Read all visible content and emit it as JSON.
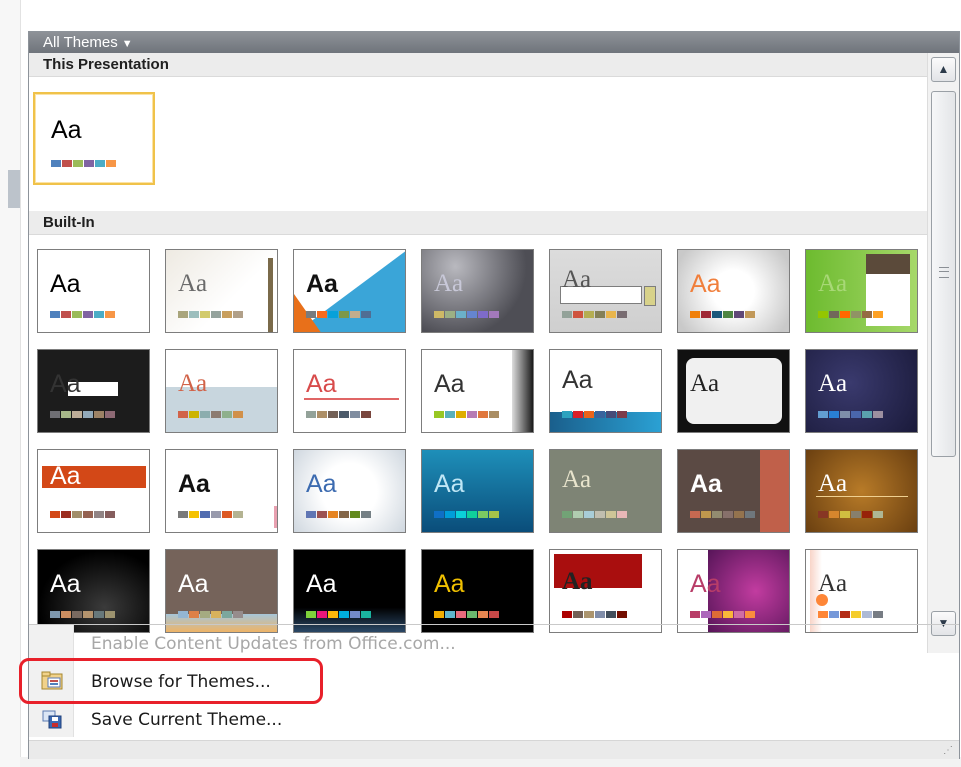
{
  "header": {
    "title": "All Themes",
    "dropdown_arrow": "▼"
  },
  "sections": {
    "this_presentation": "This Presentation",
    "built_in": "Built-In"
  },
  "thumb_label": "Aa",
  "menu": {
    "enable_updates": "Enable Content Updates from Office.com...",
    "browse": "Browse for Themes...",
    "save": "Save Current Theme..."
  },
  "scrollbar": {
    "up": "▲",
    "down": "▼"
  },
  "resize_grip": "⋰",
  "colors": {
    "highlight_ring": "#e8202a",
    "selected_border": "#f0c24a"
  },
  "icons": [
    "folder-icon",
    "save-theme-icon",
    "scroll-up-icon",
    "scroll-down-icon",
    "dropdown-arrow-icon"
  ]
}
